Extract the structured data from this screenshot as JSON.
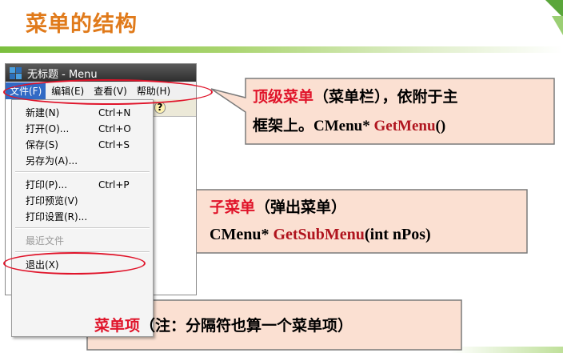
{
  "slide": {
    "title": "菜单的结构"
  },
  "window": {
    "title": "无标题 - Menu",
    "menubar": [
      "文件(F)",
      "编辑(E)",
      "查看(V)",
      "帮助(H)"
    ],
    "help_glyph": "?"
  },
  "dropdown": {
    "items": [
      {
        "label": "新建(N)",
        "shortcut": "Ctrl+N"
      },
      {
        "label": "打开(O)...",
        "shortcut": "Ctrl+O"
      },
      {
        "label": "保存(S)",
        "shortcut": "Ctrl+S"
      },
      {
        "label": "另存为(A)...",
        "shortcut": ""
      },
      {
        "label": "打印(P)...",
        "shortcut": "Ctrl+P"
      },
      {
        "label": "打印预览(V)",
        "shortcut": ""
      },
      {
        "label": "打印设置(R)...",
        "shortcut": ""
      },
      {
        "label": "最近文件",
        "shortcut": ""
      },
      {
        "label": "退出(X)",
        "shortcut": ""
      }
    ]
  },
  "callouts": {
    "top_menu": {
      "title": "顶级菜单",
      "desc": "（菜单栏），依附于主",
      "line2_prefix": "框架上。",
      "code_type": "CMenu* ",
      "code_func": "GetMenu",
      "code_args": "()"
    },
    "submenu": {
      "title": "子菜单",
      "desc": "（弹出菜单）",
      "code_type": "CMenu* ",
      "code_func": "GetSubMenu",
      "code_args": "(int nPos)"
    },
    "menu_item": {
      "title": "菜单项",
      "desc": "（注：分隔符也算一个菜单项）"
    }
  },
  "colors": {
    "title_orange": "#e07a1a",
    "accent_red": "#e0142a",
    "callout_fill": "#fbe0d2",
    "callout_border": "#7a7a7a"
  }
}
